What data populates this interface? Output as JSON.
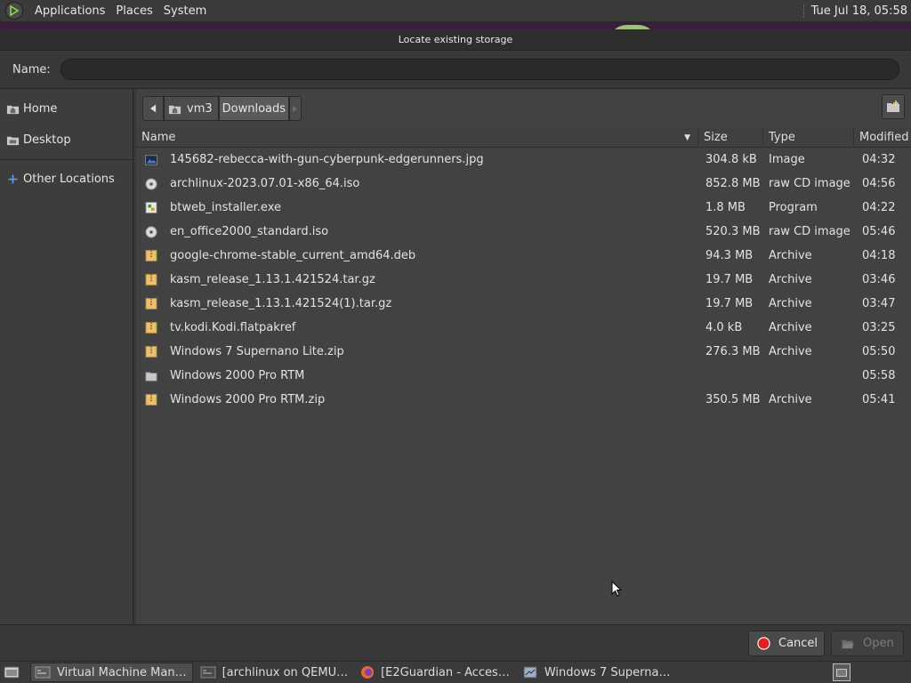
{
  "top_panel": {
    "menus": [
      "Applications",
      "Places",
      "System"
    ],
    "clock": "Tue Jul 18, 05:58"
  },
  "dialog": {
    "title": "Locate existing storage",
    "name_label": "Name:",
    "name_value": "",
    "sidebar": [
      {
        "label": "Home",
        "icon": "home-folder-icon"
      },
      {
        "label": "Desktop",
        "icon": "desktop-folder-icon"
      },
      {
        "label": "Other Locations",
        "icon": "plus-icon"
      }
    ],
    "pathbar": {
      "home_label": "vm3",
      "current_label": "Downloads"
    },
    "columns": {
      "name": "Name",
      "size": "Size",
      "type": "Type",
      "modified": "Modified"
    },
    "files": [
      {
        "name": "145682-rebecca-with-gun-cyberpunk-edgerunners.jpg",
        "size": "304.8 kB",
        "type": "Image",
        "modified": "04:32",
        "icon": "image"
      },
      {
        "name": "archlinux-2023.07.01-x86_64.iso",
        "size": "852.8 MB",
        "type": "raw CD image",
        "modified": "04:56",
        "icon": "disc"
      },
      {
        "name": "btweb_installer.exe",
        "size": "1.8 MB",
        "type": "Program",
        "modified": "04:22",
        "icon": "exe"
      },
      {
        "name": "en_office2000_standard.iso",
        "size": "520.3 MB",
        "type": "raw CD image",
        "modified": "05:46",
        "icon": "disc"
      },
      {
        "name": "google-chrome-stable_current_amd64.deb",
        "size": "94.3 MB",
        "type": "Archive",
        "modified": "04:18",
        "icon": "archive"
      },
      {
        "name": "kasm_release_1.13.1.421524.tar.gz",
        "size": "19.7 MB",
        "type": "Archive",
        "modified": "03:46",
        "icon": "archive"
      },
      {
        "name": "kasm_release_1.13.1.421524(1).tar.gz",
        "size": "19.7 MB",
        "type": "Archive",
        "modified": "03:47",
        "icon": "archive"
      },
      {
        "name": "tv.kodi.Kodi.flatpakref",
        "size": "4.0 kB",
        "type": "Archive",
        "modified": "03:25",
        "icon": "archive"
      },
      {
        "name": "Windows 7 Supernano Lite.zip",
        "size": "276.3 MB",
        "type": "Archive",
        "modified": "05:50",
        "icon": "archive"
      },
      {
        "name": "Windows 2000 Pro RTM",
        "size": "",
        "type": "",
        "modified": "05:58",
        "icon": "folder"
      },
      {
        "name": "Windows 2000 Pro RTM.zip",
        "size": "350.5 MB",
        "type": "Archive",
        "modified": "05:41",
        "icon": "archive"
      }
    ],
    "cancel_label": "Cancel",
    "open_label": "Open"
  },
  "taskbar": {
    "tasks": [
      {
        "label": "Virtual Machine Man…",
        "active": true
      },
      {
        "label": "[archlinux on QEMU…",
        "active": false
      },
      {
        "label": "[E2Guardian - Acces…",
        "active": false
      },
      {
        "label": "Windows 7 Superna…",
        "active": false
      }
    ]
  },
  "colors": {
    "accent_folder": "#e8c070",
    "cancel_red": "#e02020",
    "desktop_purple": "#3b1d3c"
  }
}
